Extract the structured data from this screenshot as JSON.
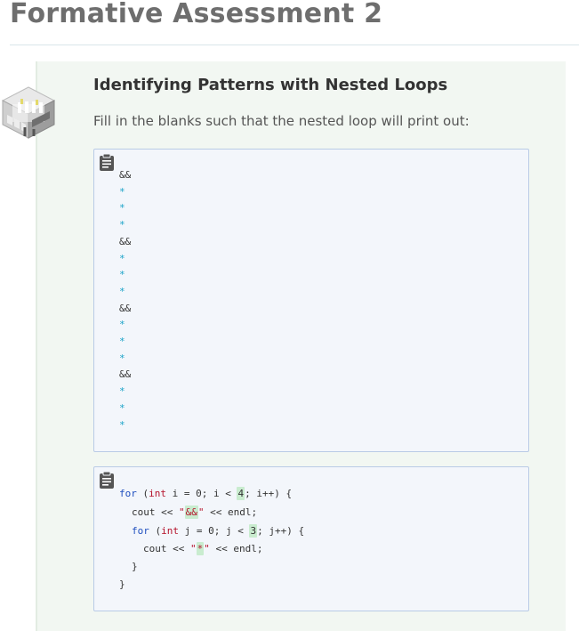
{
  "page": {
    "title": "Formative Assessment 2"
  },
  "exercise": {
    "heading": "Identifying Patterns with Nested Loops",
    "instruction": "Fill in the blanks such that the nested loop will print out:"
  },
  "output_lines": [
    "&&",
    "*",
    "*",
    "*",
    "&&",
    "*",
    "*",
    "*",
    "&&",
    "*",
    "*",
    "*",
    "&&",
    "*",
    "*",
    "*"
  ],
  "code": {
    "line1": {
      "kw_for": "for",
      "open": " (",
      "type_int": "int",
      "mid1": " i = 0; i < ",
      "blank_outer": "4",
      "end1": "; i++) {"
    },
    "line2": {
      "pre": "cout << ",
      "quote_open": "\"",
      "blank_amp": "&&",
      "quote_close": "\"",
      "post": " << endl;"
    },
    "line3": {
      "kw_for": "for",
      "open": " (",
      "type_int": "int",
      "mid1": " j = 0; j < ",
      "blank_inner": "3",
      "end1": "; j++) {"
    },
    "line4": {
      "pre": "cout << ",
      "quote_open": "\"",
      "blank_star": "*",
      "quote_close": "\"",
      "post": " << endl;"
    },
    "line5": "}",
    "line6": "}"
  },
  "colors": {
    "title": "#6e6e6e",
    "card_bg": "#f2f7f2",
    "code_bg": "#f3f6fb",
    "code_border": "#b9cbe6",
    "keyword": "#1f4fbf",
    "string": "#b5122b",
    "star_output": "#1aa3c8",
    "blank_highlight": "#c9eccf"
  },
  "icons": {
    "exercise": "isometric-cube-icon",
    "copy": "clipboard-icon"
  }
}
